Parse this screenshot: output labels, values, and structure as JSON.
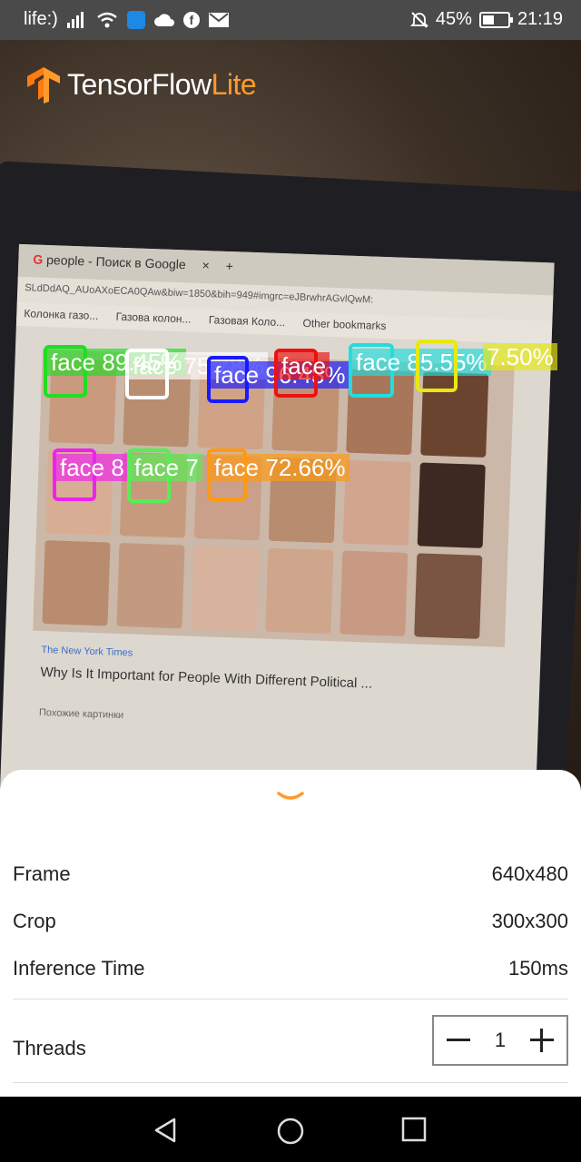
{
  "status_bar": {
    "carrier": "life:)",
    "battery": "45%",
    "battery_fraction": 0.45,
    "time": "21:19",
    "icons": [
      "signal-icon",
      "wifi-icon",
      "shield-app-icon",
      "cloud-icon",
      "facebook-icon",
      "mail-icon",
      "mute-icon",
      "battery-icon"
    ]
  },
  "logo": {
    "main": "TensorFlow",
    "suffix": "Lite"
  },
  "camera_scene": {
    "tab_title": "people - Поиск в Google",
    "tab_close": "×",
    "tab_new": "+",
    "url": "SLdDdAQ_AUoAXoECA0QAw&biw=1850&bih=949#imgrc=eJBrwhrAGvlQwM:",
    "bookmarks": [
      "Колонка газо...",
      "Газова колон...",
      "Газовая Коло...",
      "Other bookmarks"
    ],
    "news_source": "The New York Times",
    "news_title": "Why Is It Important for People With Different Political ...",
    "related": "Похожие картинки",
    "keyboard_lang": "en"
  },
  "detections": [
    {
      "label": "face 89.45%",
      "color": "#22dd22"
    },
    {
      "label": "face 75.78%",
      "color": "#ffffff"
    },
    {
      "label": "face 96.48%",
      "color": "#1a1aff"
    },
    {
      "label": "face",
      "color": "#ee1111"
    },
    {
      "label": "face 85.55%",
      "color": "#22dddd"
    },
    {
      "label": "7.50%",
      "color": "#e8e811"
    },
    {
      "label": "face 8",
      "color": "#ee22ee"
    },
    {
      "label": "face 7",
      "color": "#55ee55"
    },
    {
      "label": "face 72.66%",
      "color": "#ff9910"
    }
  ],
  "sheet": {
    "rows": [
      {
        "label": "Frame",
        "value": "640x480"
      },
      {
        "label": "Crop",
        "value": "300x300"
      },
      {
        "label": "Inference Time",
        "value": "150ms"
      }
    ],
    "threads_label": "Threads",
    "threads_value": "1",
    "accent": "#ff9b2d"
  },
  "nav": {
    "icons": [
      "back-icon",
      "home-icon",
      "recents-icon"
    ]
  }
}
